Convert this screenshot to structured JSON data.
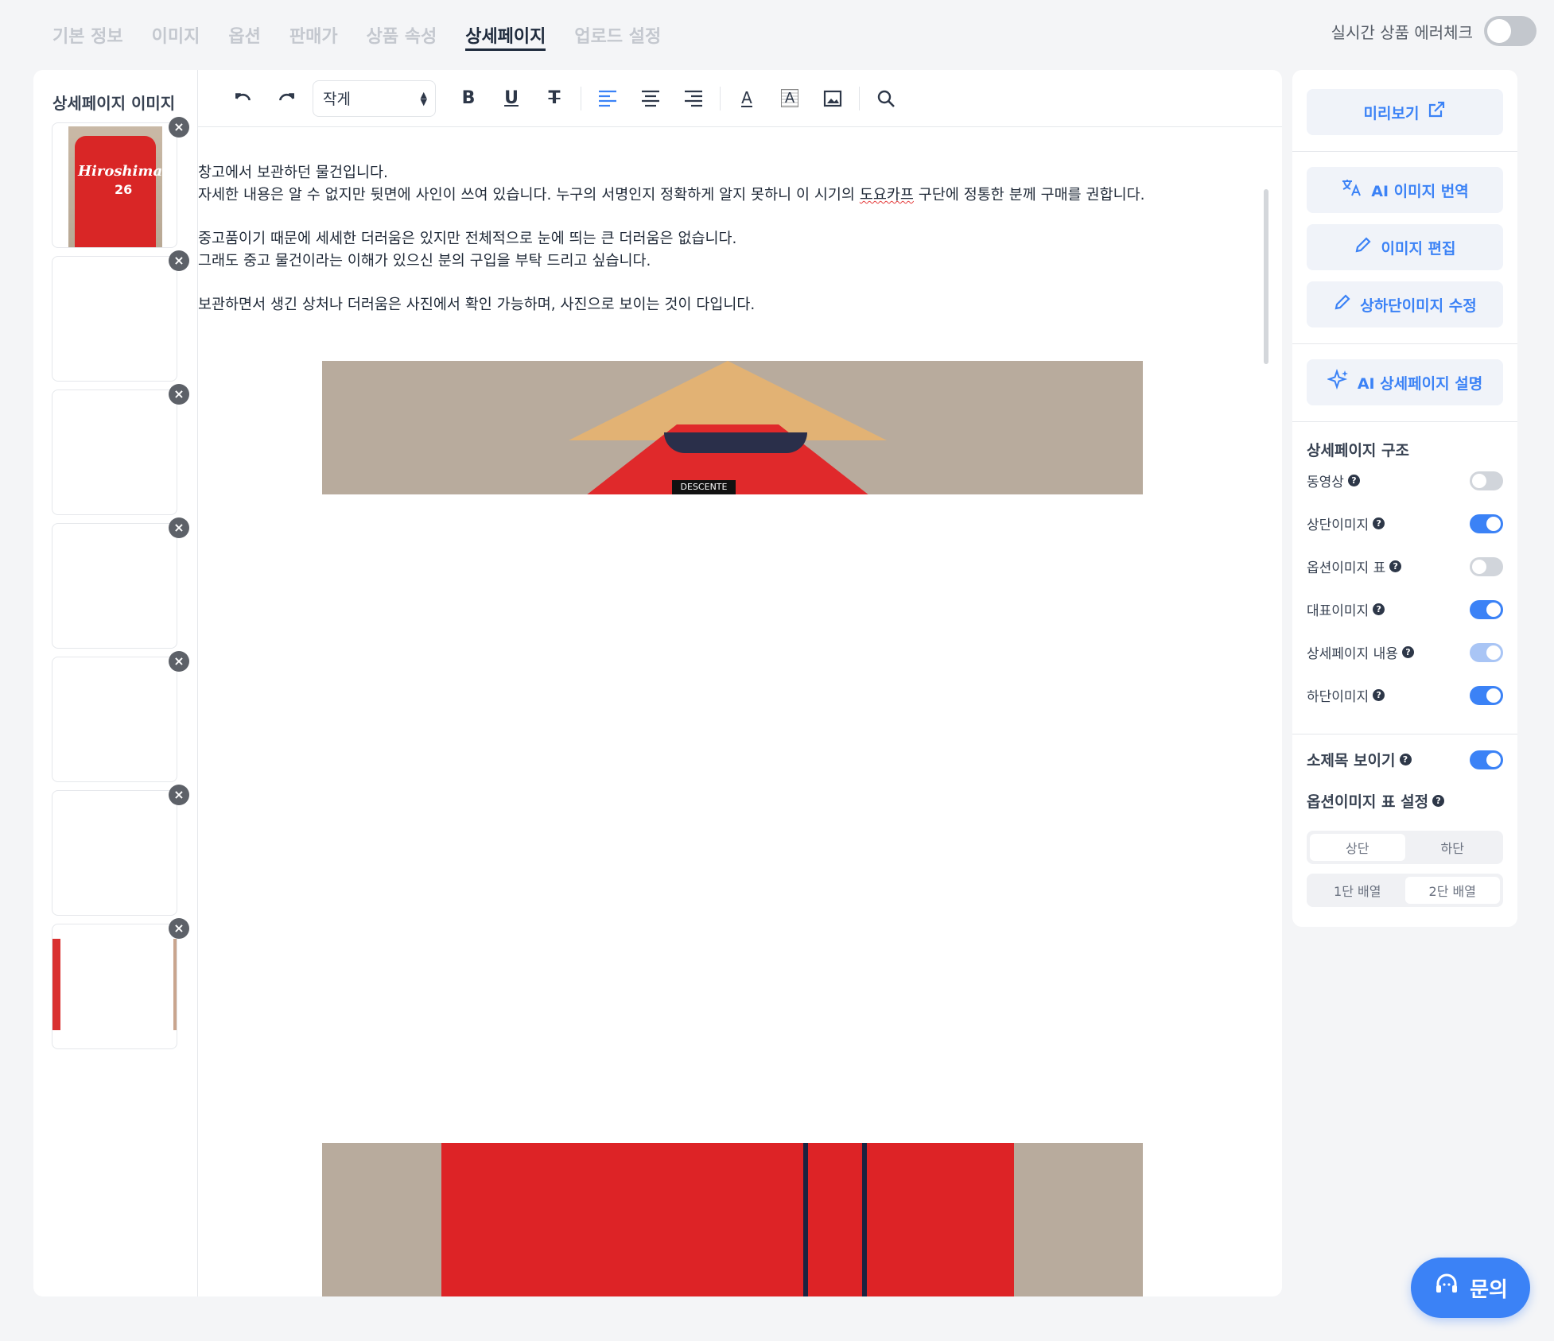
{
  "tabs": [
    {
      "label": "기본 정보",
      "active": false
    },
    {
      "label": "이미지",
      "active": false
    },
    {
      "label": "옵션",
      "active": false
    },
    {
      "label": "판매가",
      "active": false
    },
    {
      "label": "상품 속성",
      "active": false
    },
    {
      "label": "상세페이지",
      "active": true
    },
    {
      "label": "업로드 설정",
      "active": false
    }
  ],
  "realtime_check": {
    "label": "실시간 상품 에러체크",
    "on": false
  },
  "thumbnails": {
    "title": "상세페이지 이미지",
    "remove_icon": "close-icon",
    "jersey_text": "Hiroshima",
    "jersey_number": "26"
  },
  "toolbar": {
    "font_size": "작게",
    "tools": [
      "undo-icon",
      "redo-icon",
      "bold-icon",
      "underline-icon",
      "strikethrough-icon",
      "align-left-icon",
      "align-center-icon",
      "align-right-icon",
      "text-color-icon",
      "text-background-icon",
      "image-icon",
      "zoom-icon"
    ]
  },
  "editor": {
    "lines": [
      "창고에서 보관하던 물건입니다.",
      "자세한 내용은 알 수 없지만 뒷면에 사인이 쓰여 있습니다. 누구의 서명인지 정확하게 알지 못하니 이 시기의 ",
      "도요카프",
      " 구단에 정통한 분께 구매를 권합니다.",
      "중고품이기 때문에 세세한 더러움은 있지만 전체적으로 눈에 띄는 큰 더러움은 없습니다.",
      "그래도 중고 물건이라는 이해가 있으신 분의 구입을 부탁 드리고 싶습니다.",
      "보관하면서 생긴 상처나 더러움은 사진에서 확인 가능하며, 사진으로 보이는 것이 다입니다."
    ],
    "photo_tag": "DESCENTE"
  },
  "panel": {
    "preview": "미리보기",
    "ai_translate": "AI 이미지 번역",
    "image_edit": "이미지 편집",
    "top_bottom_edit": "상하단이미지 수정",
    "ai_description": "AI 상세페이지 설명",
    "structure_title": "상세페이지 구조",
    "structure": [
      {
        "label": "동영상",
        "state": "off"
      },
      {
        "label": "상단이미지",
        "state": "on"
      },
      {
        "label": "옵션이미지 표",
        "state": "off"
      },
      {
        "label": "대표이미지",
        "state": "on"
      },
      {
        "label": "상세페이지 내용",
        "state": "light"
      },
      {
        "label": "하단이미지",
        "state": "on"
      }
    ],
    "subtitle_show": {
      "label": "소제목 보이기",
      "state": "on"
    },
    "option_table_title": "옵션이미지 표 설정",
    "position": {
      "options": [
        "상단",
        "하단"
      ],
      "selected": "상단"
    },
    "layout": {
      "options": [
        "1단 배열",
        "2단 배열"
      ],
      "selected": "2단 배열"
    }
  },
  "inquiry": "문의",
  "colors": {
    "accent": "#3b82f6",
    "active_tab": "#1e2a3c"
  }
}
